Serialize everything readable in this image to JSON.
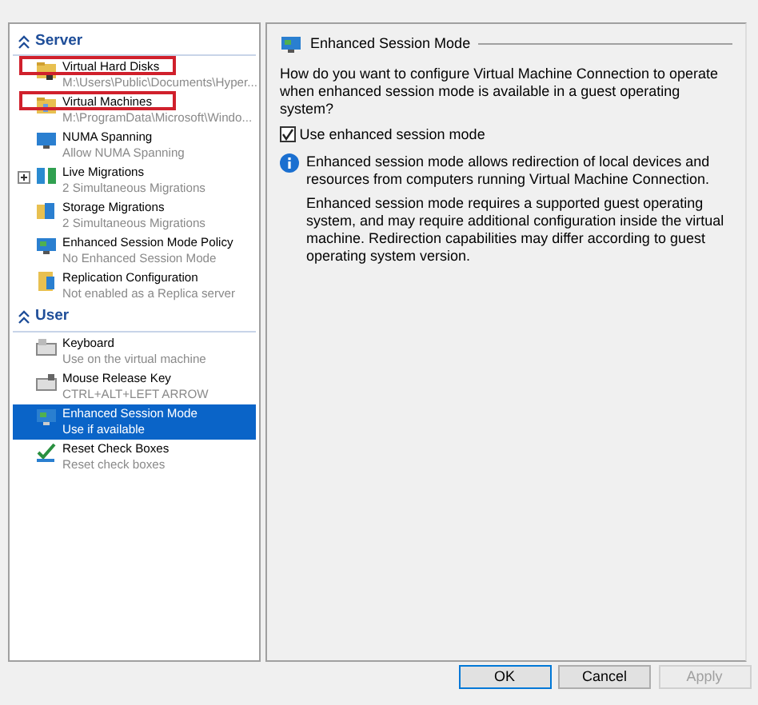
{
  "sidebar": {
    "sections": [
      {
        "title": "Server",
        "expanded": true,
        "items": [
          {
            "title": "Virtual Hard Disks",
            "subtitle": "M:\\Users\\Public\\Documents\\Hyper...",
            "selected": false,
            "highlighted": true,
            "expandable": false
          },
          {
            "title": "Virtual Machines",
            "subtitle": "M:\\ProgramData\\Microsoft\\Windo...",
            "selected": false,
            "highlighted": true,
            "expandable": false
          },
          {
            "title": "NUMA Spanning",
            "subtitle": "Allow NUMA Spanning",
            "selected": false,
            "highlighted": false,
            "expandable": false
          },
          {
            "title": "Live Migrations",
            "subtitle": "2 Simultaneous Migrations",
            "selected": false,
            "highlighted": false,
            "expandable": true,
            "expanded": false
          },
          {
            "title": "Storage Migrations",
            "subtitle": "2 Simultaneous Migrations",
            "selected": false,
            "highlighted": false,
            "expandable": false
          },
          {
            "title": "Enhanced Session Mode Policy",
            "subtitle": "No Enhanced Session Mode",
            "selected": false,
            "highlighted": false,
            "expandable": false
          },
          {
            "title": "Replication Configuration",
            "subtitle": "Not enabled as a Replica server",
            "selected": false,
            "highlighted": false,
            "expandable": false
          }
        ]
      },
      {
        "title": "User",
        "expanded": true,
        "items": [
          {
            "title": "Keyboard",
            "subtitle": "Use on the virtual machine",
            "selected": false,
            "highlighted": false,
            "expandable": false
          },
          {
            "title": "Mouse Release Key",
            "subtitle": "CTRL+ALT+LEFT ARROW",
            "selected": false,
            "highlighted": false,
            "expandable": false
          },
          {
            "title": "Enhanced Session Mode",
            "subtitle": "Use if available",
            "selected": true,
            "highlighted": false,
            "expandable": false
          },
          {
            "title": "Reset Check Boxes",
            "subtitle": "Reset check boxes",
            "selected": false,
            "highlighted": false,
            "expandable": false
          }
        ]
      }
    ]
  },
  "panel": {
    "title": "Enhanced Session Mode",
    "question": "How do you want to configure Virtual Machine Connection to operate when enhanced session mode is available in a guest operating system?",
    "checkbox": {
      "label": "Use enhanced session mode",
      "checked": true
    },
    "info": [
      "Enhanced session mode allows redirection of local devices and resources from computers running Virtual Machine Connection.",
      "Enhanced session mode requires a supported guest operating system, and may require additional configuration inside the virtual machine. Redirection capabilities may differ according to guest operating system version."
    ]
  },
  "buttons": [
    {
      "label": "OK",
      "default": true,
      "disabled": false
    },
    {
      "label": "Cancel",
      "default": false,
      "disabled": false
    },
    {
      "label": "Apply",
      "default": false,
      "disabled": true
    }
  ]
}
